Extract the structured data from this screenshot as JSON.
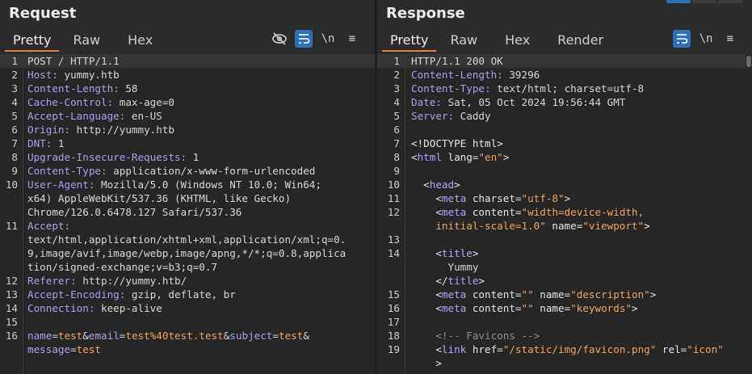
{
  "request": {
    "title": "Request",
    "tabs": [
      "Pretty",
      "Raw",
      "Hex"
    ],
    "lines": [
      {
        "n": "1",
        "parts": [
          {
            "t": "POST / HTTP/1.1",
            "c": "v"
          }
        ]
      },
      {
        "n": "2",
        "parts": [
          {
            "t": "Host:",
            "c": "k"
          },
          {
            "t": " yummy.htb",
            "c": "v"
          }
        ]
      },
      {
        "n": "3",
        "parts": [
          {
            "t": "Content-Length:",
            "c": "k"
          },
          {
            "t": " 58",
            "c": "v"
          }
        ]
      },
      {
        "n": "4",
        "parts": [
          {
            "t": "Cache-Control:",
            "c": "k"
          },
          {
            "t": " max-age=0",
            "c": "v"
          }
        ]
      },
      {
        "n": "5",
        "parts": [
          {
            "t": "Accept-Language:",
            "c": "k"
          },
          {
            "t": " en-US",
            "c": "v"
          }
        ]
      },
      {
        "n": "6",
        "parts": [
          {
            "t": "Origin:",
            "c": "k"
          },
          {
            "t": " http://yummy.htb",
            "c": "v"
          }
        ]
      },
      {
        "n": "7",
        "parts": [
          {
            "t": "DNT:",
            "c": "k"
          },
          {
            "t": " 1",
            "c": "v"
          }
        ]
      },
      {
        "n": "8",
        "parts": [
          {
            "t": "Upgrade-Insecure-Requests:",
            "c": "k"
          },
          {
            "t": " 1",
            "c": "v"
          }
        ]
      },
      {
        "n": "9",
        "parts": [
          {
            "t": "Content-Type:",
            "c": "k"
          },
          {
            "t": " application/x-www-form-urlencoded",
            "c": "v"
          }
        ]
      },
      {
        "n": "10",
        "parts": [
          {
            "t": "User-Agent:",
            "c": "k"
          },
          {
            "t": " Mozilla/5.0 (Windows NT 10.0; Win64;",
            "c": "v"
          }
        ]
      },
      {
        "n": "",
        "parts": [
          {
            "t": "x64) AppleWebKit/537.36 (KHTML, like Gecko)",
            "c": "v"
          }
        ]
      },
      {
        "n": "",
        "parts": [
          {
            "t": "Chrome/126.0.6478.127 Safari/537.36",
            "c": "v"
          }
        ]
      },
      {
        "n": "11",
        "parts": [
          {
            "t": "Accept:",
            "c": "k"
          }
        ]
      },
      {
        "n": "",
        "parts": [
          {
            "t": "text/html,application/xhtml+xml,application/xml;q=0.",
            "c": "v"
          }
        ]
      },
      {
        "n": "",
        "parts": [
          {
            "t": "9,image/avif,image/webp,image/apng,*/*;q=0.8,applica",
            "c": "v"
          }
        ]
      },
      {
        "n": "",
        "parts": [
          {
            "t": "tion/signed-exchange;v=b3;q=0.7",
            "c": "v"
          }
        ]
      },
      {
        "n": "12",
        "parts": [
          {
            "t": "Referer:",
            "c": "k"
          },
          {
            "t": " http://yummy.htb/",
            "c": "v"
          }
        ]
      },
      {
        "n": "13",
        "parts": [
          {
            "t": "Accept-Encoding:",
            "c": "k"
          },
          {
            "t": " gzip, deflate, br",
            "c": "v"
          }
        ]
      },
      {
        "n": "14",
        "parts": [
          {
            "t": "Connection:",
            "c": "k"
          },
          {
            "t": " keep-alive",
            "c": "v"
          }
        ]
      },
      {
        "n": "15",
        "parts": []
      },
      {
        "n": "16",
        "parts": [
          {
            "t": "name",
            "c": "pk"
          },
          {
            "t": "=",
            "c": "v"
          },
          {
            "t": "test",
            "c": "pv"
          },
          {
            "t": "&",
            "c": "v"
          },
          {
            "t": "email",
            "c": "pk"
          },
          {
            "t": "=",
            "c": "v"
          },
          {
            "t": "test%40test.test",
            "c": "pv"
          },
          {
            "t": "&",
            "c": "v"
          },
          {
            "t": "subject",
            "c": "pk"
          },
          {
            "t": "=",
            "c": "v"
          },
          {
            "t": "test",
            "c": "pv"
          },
          {
            "t": "&",
            "c": "v"
          }
        ]
      },
      {
        "n": "",
        "parts": [
          {
            "t": "message",
            "c": "pk"
          },
          {
            "t": "=",
            "c": "v"
          },
          {
            "t": "test",
            "c": "pv"
          }
        ]
      }
    ]
  },
  "response": {
    "title": "Response",
    "tabs": [
      "Pretty",
      "Raw",
      "Hex",
      "Render"
    ],
    "lines": [
      {
        "n": "1",
        "parts": [
          {
            "t": "HTTP/1.1 200 OK",
            "c": "v"
          }
        ]
      },
      {
        "n": "2",
        "parts": [
          {
            "t": "Content-Length:",
            "c": "k"
          },
          {
            "t": " 39296",
            "c": "v"
          }
        ]
      },
      {
        "n": "3",
        "parts": [
          {
            "t": "Content-Type:",
            "c": "k"
          },
          {
            "t": " text/html; charset=utf-8",
            "c": "v"
          }
        ]
      },
      {
        "n": "4",
        "parts": [
          {
            "t": "Date:",
            "c": "k"
          },
          {
            "t": " Sat, 05 Oct 2024 19:56:44 GMT",
            "c": "v"
          }
        ]
      },
      {
        "n": "5",
        "parts": [
          {
            "t": "Server:",
            "c": "k"
          },
          {
            "t": " Caddy",
            "c": "v"
          }
        ]
      },
      {
        "n": "6",
        "parts": []
      },
      {
        "n": "7",
        "parts": [
          {
            "t": "<!DOCTYPE html>",
            "c": "tag"
          }
        ]
      },
      {
        "n": "8",
        "parts": [
          {
            "t": "<",
            "c": "tag"
          },
          {
            "t": "html",
            "c": "tname"
          },
          {
            "t": " lang=",
            "c": "tag"
          },
          {
            "t": "\"en\"",
            "c": "aval"
          },
          {
            "t": ">",
            "c": "tag"
          }
        ]
      },
      {
        "n": "9",
        "parts": []
      },
      {
        "n": "10",
        "parts": [
          {
            "t": "  <",
            "c": "tag"
          },
          {
            "t": "head",
            "c": "tname"
          },
          {
            "t": ">",
            "c": "tag"
          }
        ]
      },
      {
        "n": "11",
        "parts": [
          {
            "t": "    <",
            "c": "tag"
          },
          {
            "t": "meta",
            "c": "tname"
          },
          {
            "t": " charset=",
            "c": "tag"
          },
          {
            "t": "\"utf-8\"",
            "c": "aval"
          },
          {
            "t": ">",
            "c": "tag"
          }
        ]
      },
      {
        "n": "12",
        "parts": [
          {
            "t": "    <",
            "c": "tag"
          },
          {
            "t": "meta",
            "c": "tname"
          },
          {
            "t": " content=",
            "c": "tag"
          },
          {
            "t": "\"width=device-width,",
            "c": "aval"
          }
        ]
      },
      {
        "n": "",
        "parts": [
          {
            "t": "    initial-scale=1.0\"",
            "c": "aval"
          },
          {
            "t": " name=",
            "c": "tag"
          },
          {
            "t": "\"viewport\"",
            "c": "aval"
          },
          {
            "t": ">",
            "c": "tag"
          }
        ]
      },
      {
        "n": "13",
        "parts": []
      },
      {
        "n": "14",
        "parts": [
          {
            "t": "    <",
            "c": "tag"
          },
          {
            "t": "title",
            "c": "tname"
          },
          {
            "t": ">",
            "c": "tag"
          }
        ]
      },
      {
        "n": "",
        "parts": [
          {
            "t": "      Yummy",
            "c": "v"
          }
        ]
      },
      {
        "n": "",
        "parts": [
          {
            "t": "    </",
            "c": "tag"
          },
          {
            "t": "title",
            "c": "tname"
          },
          {
            "t": ">",
            "c": "tag"
          }
        ]
      },
      {
        "n": "15",
        "parts": [
          {
            "t": "    <",
            "c": "tag"
          },
          {
            "t": "meta",
            "c": "tname"
          },
          {
            "t": " content=",
            "c": "tag"
          },
          {
            "t": "\"\"",
            "c": "aval"
          },
          {
            "t": " name=",
            "c": "tag"
          },
          {
            "t": "\"description\"",
            "c": "aval"
          },
          {
            "t": ">",
            "c": "tag"
          }
        ]
      },
      {
        "n": "16",
        "parts": [
          {
            "t": "    <",
            "c": "tag"
          },
          {
            "t": "meta",
            "c": "tname"
          },
          {
            "t": " content=",
            "c": "tag"
          },
          {
            "t": "\"\"",
            "c": "aval"
          },
          {
            "t": " name=",
            "c": "tag"
          },
          {
            "t": "\"keywords\"",
            "c": "aval"
          },
          {
            "t": ">",
            "c": "tag"
          }
        ]
      },
      {
        "n": "17",
        "parts": []
      },
      {
        "n": "18",
        "parts": [
          {
            "t": "    <!-- Favicons -->",
            "c": "cm"
          }
        ]
      },
      {
        "n": "19",
        "parts": [
          {
            "t": "    <",
            "c": "tag"
          },
          {
            "t": "link",
            "c": "tname"
          },
          {
            "t": " href=",
            "c": "tag"
          },
          {
            "t": "\"/static/img/favicon.png\"",
            "c": "aval"
          },
          {
            "t": " rel=",
            "c": "tag"
          },
          {
            "t": "\"icon\"",
            "c": "aval"
          }
        ]
      },
      {
        "n": "",
        "parts": [
          {
            "t": "    >",
            "c": "tag"
          }
        ]
      }
    ]
  },
  "toolbar": {
    "newline_label": "\\n",
    "menu_label": "≡"
  }
}
